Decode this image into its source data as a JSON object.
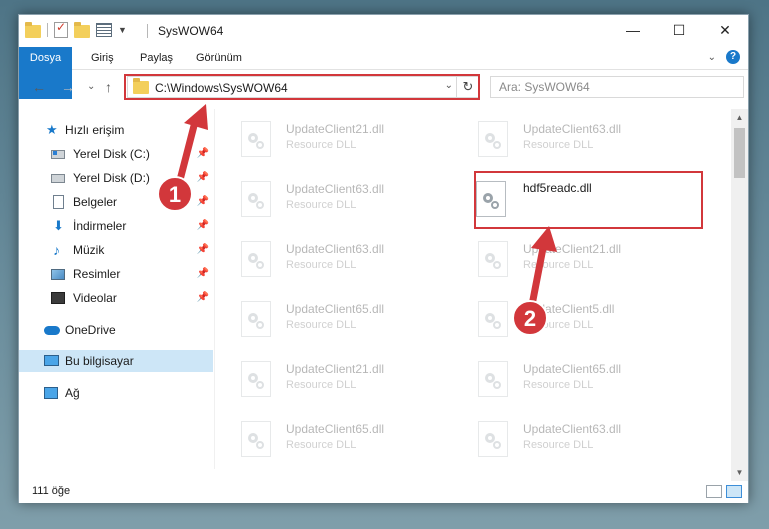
{
  "window": {
    "title": "SysWOW64",
    "controls": {
      "minimize": "—",
      "maximize": "☐",
      "close": "✕"
    }
  },
  "ribbon": {
    "tabs": [
      "Dosya",
      "Giriş",
      "Paylaş",
      "Görünüm"
    ],
    "help": "?",
    "expand": "⌄"
  },
  "navigation": {
    "back": "←",
    "forward": "→",
    "recent": "⌄",
    "up": "↑",
    "address": "C:\\Windows\\SysWOW64",
    "address_dropdown": "⌄",
    "refresh": "↻",
    "search_placeholder": "Ara: SysWOW64"
  },
  "sidebar": {
    "items": [
      {
        "label": "Hızlı erişim",
        "icon": "star-icon",
        "pinned": false
      },
      {
        "label": "Yerel Disk (C:)",
        "icon": "drive-c-icon",
        "pinned": true
      },
      {
        "label": "Yerel Disk (D:)",
        "icon": "drive-d-icon",
        "pinned": true
      },
      {
        "label": "Belgeler",
        "icon": "documents-icon",
        "pinned": true
      },
      {
        "label": "İndirmeler",
        "icon": "downloads-icon",
        "pinned": true
      },
      {
        "label": "Müzik",
        "icon": "music-icon",
        "pinned": true
      },
      {
        "label": "Resimler",
        "icon": "pictures-icon",
        "pinned": true
      },
      {
        "label": "Videolar",
        "icon": "videos-icon",
        "pinned": true
      },
      {
        "label": "OneDrive",
        "icon": "onedrive-icon",
        "pinned": false
      },
      {
        "label": "Bu bilgisayar",
        "icon": "this-pc-icon",
        "pinned": false,
        "selected": true
      },
      {
        "label": "Ağ",
        "icon": "network-icon",
        "pinned": false
      }
    ],
    "pin_glyph": "📌"
  },
  "files": [
    {
      "name": "UpdateClient21.dll",
      "type": "Resource DLL",
      "faded": true
    },
    {
      "name": "UpdateClient63.dll",
      "type": "Resource DLL",
      "faded": true
    },
    {
      "name": "UpdateClient63.dll",
      "type": "Resource DLL",
      "faded": true
    },
    {
      "name": "hdf5readc.dll",
      "type": "",
      "faded": false,
      "highlighted": true
    },
    {
      "name": "UpdateClient63.dll",
      "type": "Resource DLL",
      "faded": true
    },
    {
      "name": "UpdateClient21.dll",
      "type": "Resource DLL",
      "faded": true
    },
    {
      "name": "UpdateClient65.dll",
      "type": "Resource DLL",
      "faded": true
    },
    {
      "name": "UpdateClient5.dll",
      "type": "Resource DLL",
      "faded": true
    },
    {
      "name": "UpdateClient21.dll",
      "type": "Resource DLL",
      "faded": true
    },
    {
      "name": "UpdateClient65.dll",
      "type": "Resource DLL",
      "faded": true
    },
    {
      "name": "UpdateClient65.dll",
      "type": "Resource DLL",
      "faded": true
    },
    {
      "name": "UpdateClient63.dll",
      "type": "Resource DLL",
      "faded": true
    }
  ],
  "status": {
    "item_count": "111 öğe"
  },
  "annotations": [
    {
      "number": "1",
      "color": "#d2373b"
    },
    {
      "number": "2",
      "color": "#d2373b"
    }
  ],
  "colors": {
    "accent": "#1979ca",
    "highlight": "#d2373b",
    "selected": "#cde6f7"
  }
}
